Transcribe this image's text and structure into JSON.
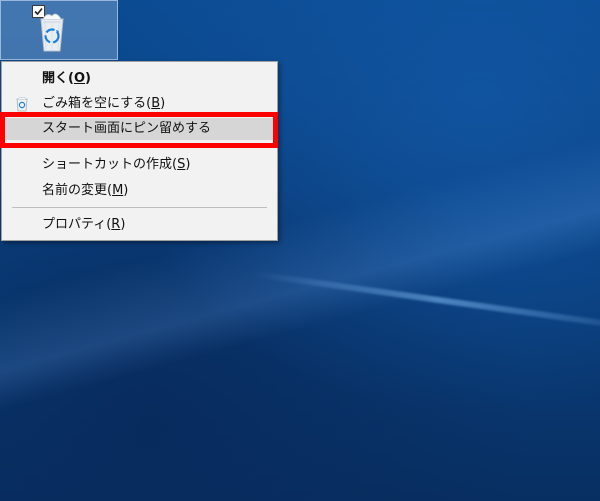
{
  "desktop": {
    "icon": {
      "name": "recycle-bin",
      "selected": true
    }
  },
  "context_menu": {
    "items": [
      {
        "label": "開く(",
        "mnemonic": "O",
        "suffix": ")"
      },
      {
        "label": "ごみ箱を空にする(",
        "mnemonic": "B",
        "suffix": ")"
      },
      {
        "label": "スタート画面にピン留めする",
        "mnemonic": "",
        "suffix": ""
      },
      {
        "label": "ショートカットの作成(",
        "mnemonic": "S",
        "suffix": ")"
      },
      {
        "label": "名前の変更(",
        "mnemonic": "M",
        "suffix": ")"
      },
      {
        "label": "プロパティ(",
        "mnemonic": "R",
        "suffix": ")"
      }
    ]
  },
  "colors": {
    "highlight_border": "#ff0000",
    "menu_background": "#f2f2f2",
    "menu_highlight": "#d6d6d6",
    "desktop_background": "#0a3f7d"
  }
}
